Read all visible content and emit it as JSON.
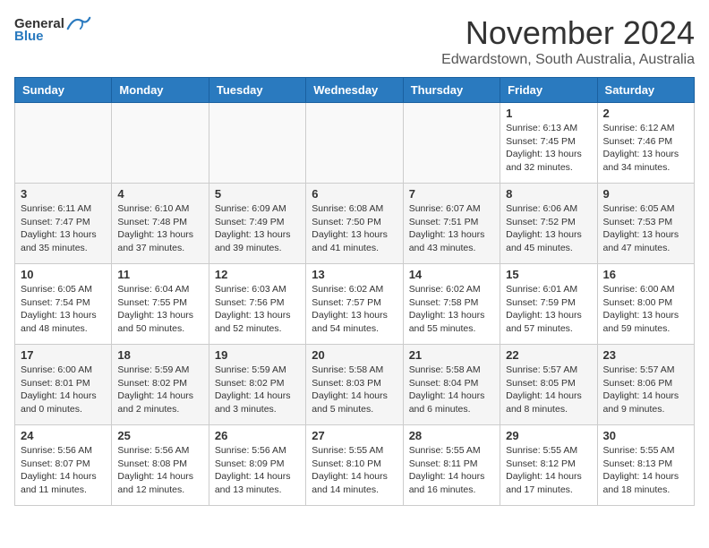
{
  "header": {
    "logo_general": "General",
    "logo_blue": "Blue",
    "month": "November 2024",
    "location": "Edwardstown, South Australia, Australia"
  },
  "weekdays": [
    "Sunday",
    "Monday",
    "Tuesday",
    "Wednesday",
    "Thursday",
    "Friday",
    "Saturday"
  ],
  "weeks": [
    [
      {
        "day": "",
        "info": ""
      },
      {
        "day": "",
        "info": ""
      },
      {
        "day": "",
        "info": ""
      },
      {
        "day": "",
        "info": ""
      },
      {
        "day": "",
        "info": ""
      },
      {
        "day": "1",
        "info": "Sunrise: 6:13 AM\nSunset: 7:45 PM\nDaylight: 13 hours and 32 minutes."
      },
      {
        "day": "2",
        "info": "Sunrise: 6:12 AM\nSunset: 7:46 PM\nDaylight: 13 hours and 34 minutes."
      }
    ],
    [
      {
        "day": "3",
        "info": "Sunrise: 6:11 AM\nSunset: 7:47 PM\nDaylight: 13 hours and 35 minutes."
      },
      {
        "day": "4",
        "info": "Sunrise: 6:10 AM\nSunset: 7:48 PM\nDaylight: 13 hours and 37 minutes."
      },
      {
        "day": "5",
        "info": "Sunrise: 6:09 AM\nSunset: 7:49 PM\nDaylight: 13 hours and 39 minutes."
      },
      {
        "day": "6",
        "info": "Sunrise: 6:08 AM\nSunset: 7:50 PM\nDaylight: 13 hours and 41 minutes."
      },
      {
        "day": "7",
        "info": "Sunrise: 6:07 AM\nSunset: 7:51 PM\nDaylight: 13 hours and 43 minutes."
      },
      {
        "day": "8",
        "info": "Sunrise: 6:06 AM\nSunset: 7:52 PM\nDaylight: 13 hours and 45 minutes."
      },
      {
        "day": "9",
        "info": "Sunrise: 6:05 AM\nSunset: 7:53 PM\nDaylight: 13 hours and 47 minutes."
      }
    ],
    [
      {
        "day": "10",
        "info": "Sunrise: 6:05 AM\nSunset: 7:54 PM\nDaylight: 13 hours and 48 minutes."
      },
      {
        "day": "11",
        "info": "Sunrise: 6:04 AM\nSunset: 7:55 PM\nDaylight: 13 hours and 50 minutes."
      },
      {
        "day": "12",
        "info": "Sunrise: 6:03 AM\nSunset: 7:56 PM\nDaylight: 13 hours and 52 minutes."
      },
      {
        "day": "13",
        "info": "Sunrise: 6:02 AM\nSunset: 7:57 PM\nDaylight: 13 hours and 54 minutes."
      },
      {
        "day": "14",
        "info": "Sunrise: 6:02 AM\nSunset: 7:58 PM\nDaylight: 13 hours and 55 minutes."
      },
      {
        "day": "15",
        "info": "Sunrise: 6:01 AM\nSunset: 7:59 PM\nDaylight: 13 hours and 57 minutes."
      },
      {
        "day": "16",
        "info": "Sunrise: 6:00 AM\nSunset: 8:00 PM\nDaylight: 13 hours and 59 minutes."
      }
    ],
    [
      {
        "day": "17",
        "info": "Sunrise: 6:00 AM\nSunset: 8:01 PM\nDaylight: 14 hours and 0 minutes."
      },
      {
        "day": "18",
        "info": "Sunrise: 5:59 AM\nSunset: 8:02 PM\nDaylight: 14 hours and 2 minutes."
      },
      {
        "day": "19",
        "info": "Sunrise: 5:59 AM\nSunset: 8:02 PM\nDaylight: 14 hours and 3 minutes."
      },
      {
        "day": "20",
        "info": "Sunrise: 5:58 AM\nSunset: 8:03 PM\nDaylight: 14 hours and 5 minutes."
      },
      {
        "day": "21",
        "info": "Sunrise: 5:58 AM\nSunset: 8:04 PM\nDaylight: 14 hours and 6 minutes."
      },
      {
        "day": "22",
        "info": "Sunrise: 5:57 AM\nSunset: 8:05 PM\nDaylight: 14 hours and 8 minutes."
      },
      {
        "day": "23",
        "info": "Sunrise: 5:57 AM\nSunset: 8:06 PM\nDaylight: 14 hours and 9 minutes."
      }
    ],
    [
      {
        "day": "24",
        "info": "Sunrise: 5:56 AM\nSunset: 8:07 PM\nDaylight: 14 hours and 11 minutes."
      },
      {
        "day": "25",
        "info": "Sunrise: 5:56 AM\nSunset: 8:08 PM\nDaylight: 14 hours and 12 minutes."
      },
      {
        "day": "26",
        "info": "Sunrise: 5:56 AM\nSunset: 8:09 PM\nDaylight: 14 hours and 13 minutes."
      },
      {
        "day": "27",
        "info": "Sunrise: 5:55 AM\nSunset: 8:10 PM\nDaylight: 14 hours and 14 minutes."
      },
      {
        "day": "28",
        "info": "Sunrise: 5:55 AM\nSunset: 8:11 PM\nDaylight: 14 hours and 16 minutes."
      },
      {
        "day": "29",
        "info": "Sunrise: 5:55 AM\nSunset: 8:12 PM\nDaylight: 14 hours and 17 minutes."
      },
      {
        "day": "30",
        "info": "Sunrise: 5:55 AM\nSunset: 8:13 PM\nDaylight: 14 hours and 18 minutes."
      }
    ]
  ]
}
